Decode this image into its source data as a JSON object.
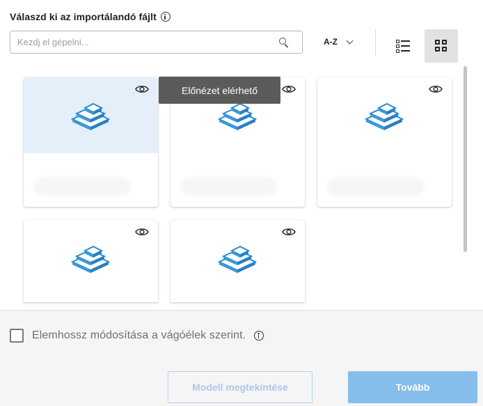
{
  "header": {
    "title": "Válaszd ki az importálandó fájlt"
  },
  "search": {
    "placeholder": "Kezdj el gépelni..."
  },
  "sort": {
    "label": "A-Z"
  },
  "tooltip": {
    "text": "Előnézet elérhető"
  },
  "files": [
    {
      "selected": true
    },
    {
      "selected": false
    },
    {
      "selected": false
    },
    {
      "selected": false
    },
    {
      "selected": false
    }
  ],
  "option": {
    "label": "Elemhossz módosítása a vágóélek szerint."
  },
  "buttons": {
    "view_model": "Modell megtekintése",
    "next": "Tovább"
  },
  "icons": {
    "info": "info-icon",
    "search": "search-icon",
    "sort": "chevron-down-icon",
    "list_view": "list-view-icon",
    "grid_view": "grid-view-icon",
    "preview": "eye-icon",
    "file_type": "3d-model-icon"
  },
  "colors": {
    "selected_bg": "#e5effa",
    "primary": "#86bdea",
    "tooltip_bg": "#5b5b5b",
    "icon_blue": "#3a9ad9"
  }
}
